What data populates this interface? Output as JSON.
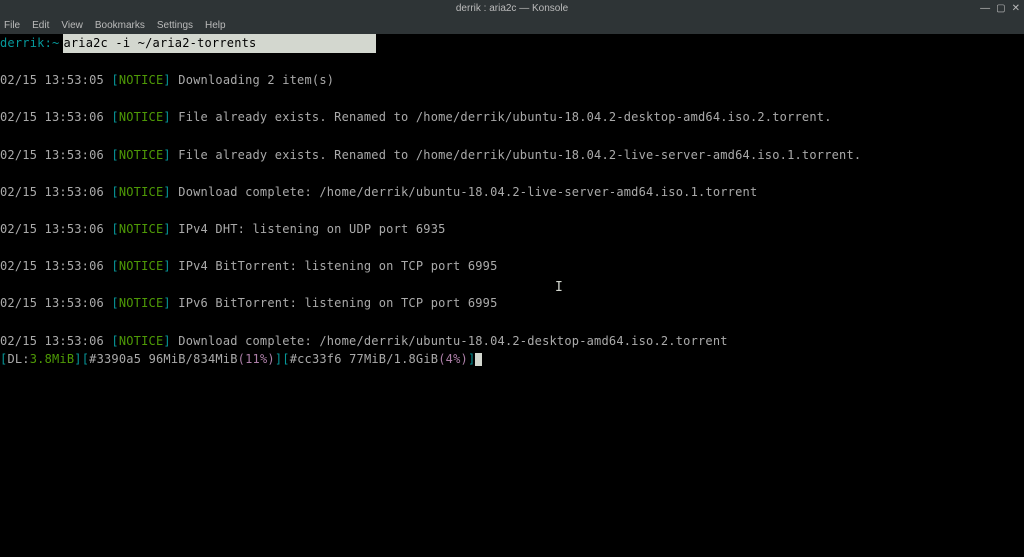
{
  "titlebar": {
    "title": "derrik : aria2c — Konsole"
  },
  "window_controls": {
    "min": "—",
    "max": "▢",
    "close": "✕"
  },
  "menubar": {
    "items": [
      "File",
      "Edit",
      "View",
      "Bookmarks",
      "Settings",
      "Help"
    ]
  },
  "prompt": {
    "user": "derrik",
    "cwd": "~",
    "sep": ":",
    "command": "aria2c -i ~/aria2-torrents"
  },
  "log": [
    {
      "ts": "02/15 13:53:05",
      "tag": "NOTICE",
      "msg": "Downloading 2 item(s)"
    },
    {
      "ts": "02/15 13:53:06",
      "tag": "NOTICE",
      "msg": "File already exists. Renamed to /home/derrik/ubuntu-18.04.2-desktop-amd64.iso.2.torrent."
    },
    {
      "ts": "02/15 13:53:06",
      "tag": "NOTICE",
      "msg": "File already exists. Renamed to /home/derrik/ubuntu-18.04.2-live-server-amd64.iso.1.torrent."
    },
    {
      "ts": "02/15 13:53:06",
      "tag": "NOTICE",
      "msg": "Download complete: /home/derrik/ubuntu-18.04.2-live-server-amd64.iso.1.torrent"
    },
    {
      "ts": "02/15 13:53:06",
      "tag": "NOTICE",
      "msg": "IPv4 DHT: listening on UDP port 6935"
    },
    {
      "ts": "02/15 13:53:06",
      "tag": "NOTICE",
      "msg": "IPv4 BitTorrent: listening on TCP port 6995"
    },
    {
      "ts": "02/15 13:53:06",
      "tag": "NOTICE",
      "msg": "IPv6 BitTorrent: listening on TCP port 6995"
    },
    {
      "ts": "02/15 13:53:06",
      "tag": "NOTICE",
      "msg": "Download complete: /home/derrik/ubuntu-18.04.2-desktop-amd64.iso.2.torrent"
    }
  ],
  "status": {
    "dl_label": "DL:",
    "dl_speed": "3.8MiB",
    "item1": {
      "gid": "#3390a5",
      "progress": "96MiB/834MiB",
      "pct": "11%"
    },
    "item2": {
      "gid": "#cc33f6",
      "progress": "77MiB/1.8GiB",
      "pct": "4%"
    }
  }
}
